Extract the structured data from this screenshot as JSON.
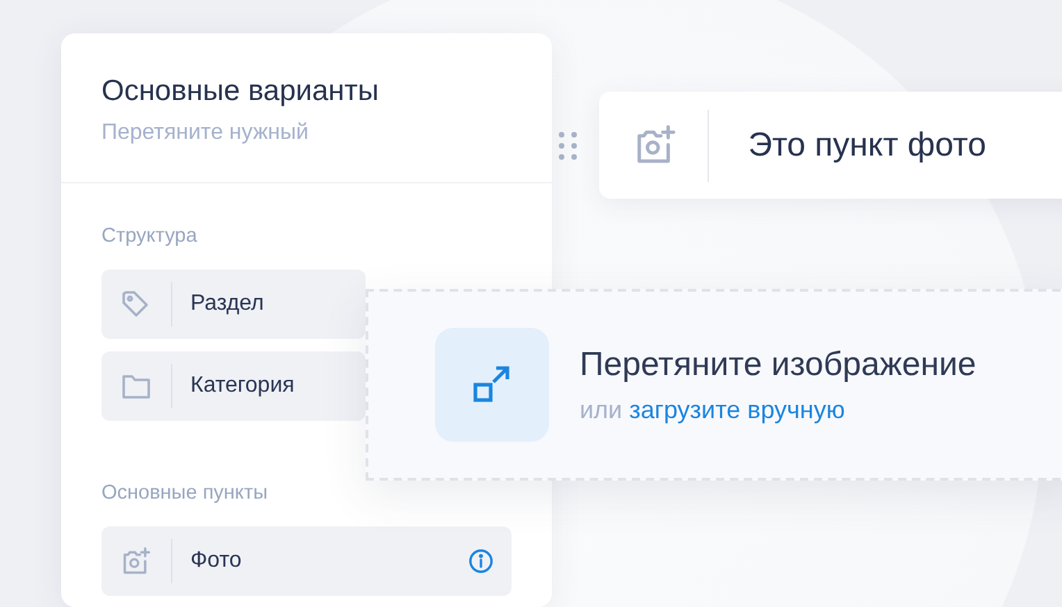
{
  "panel": {
    "title": "Основные варианты",
    "subtitle": "Перетяните нужный",
    "sections": [
      {
        "heading": "Структура",
        "items": [
          {
            "label": "Раздел",
            "kind": "tag",
            "info": false
          },
          {
            "label": "Категория",
            "kind": "folder",
            "info": false
          }
        ]
      },
      {
        "heading": "Основные пункты",
        "items": [
          {
            "label": "Фото",
            "kind": "camera",
            "info": true
          }
        ]
      }
    ]
  },
  "dragged_item": {
    "label": "Это пункт фото",
    "kind": "camera"
  },
  "dropzone": {
    "title": "Перетяните изображение",
    "hint_prefix": "или",
    "hint_link": "загрузите вручную"
  }
}
